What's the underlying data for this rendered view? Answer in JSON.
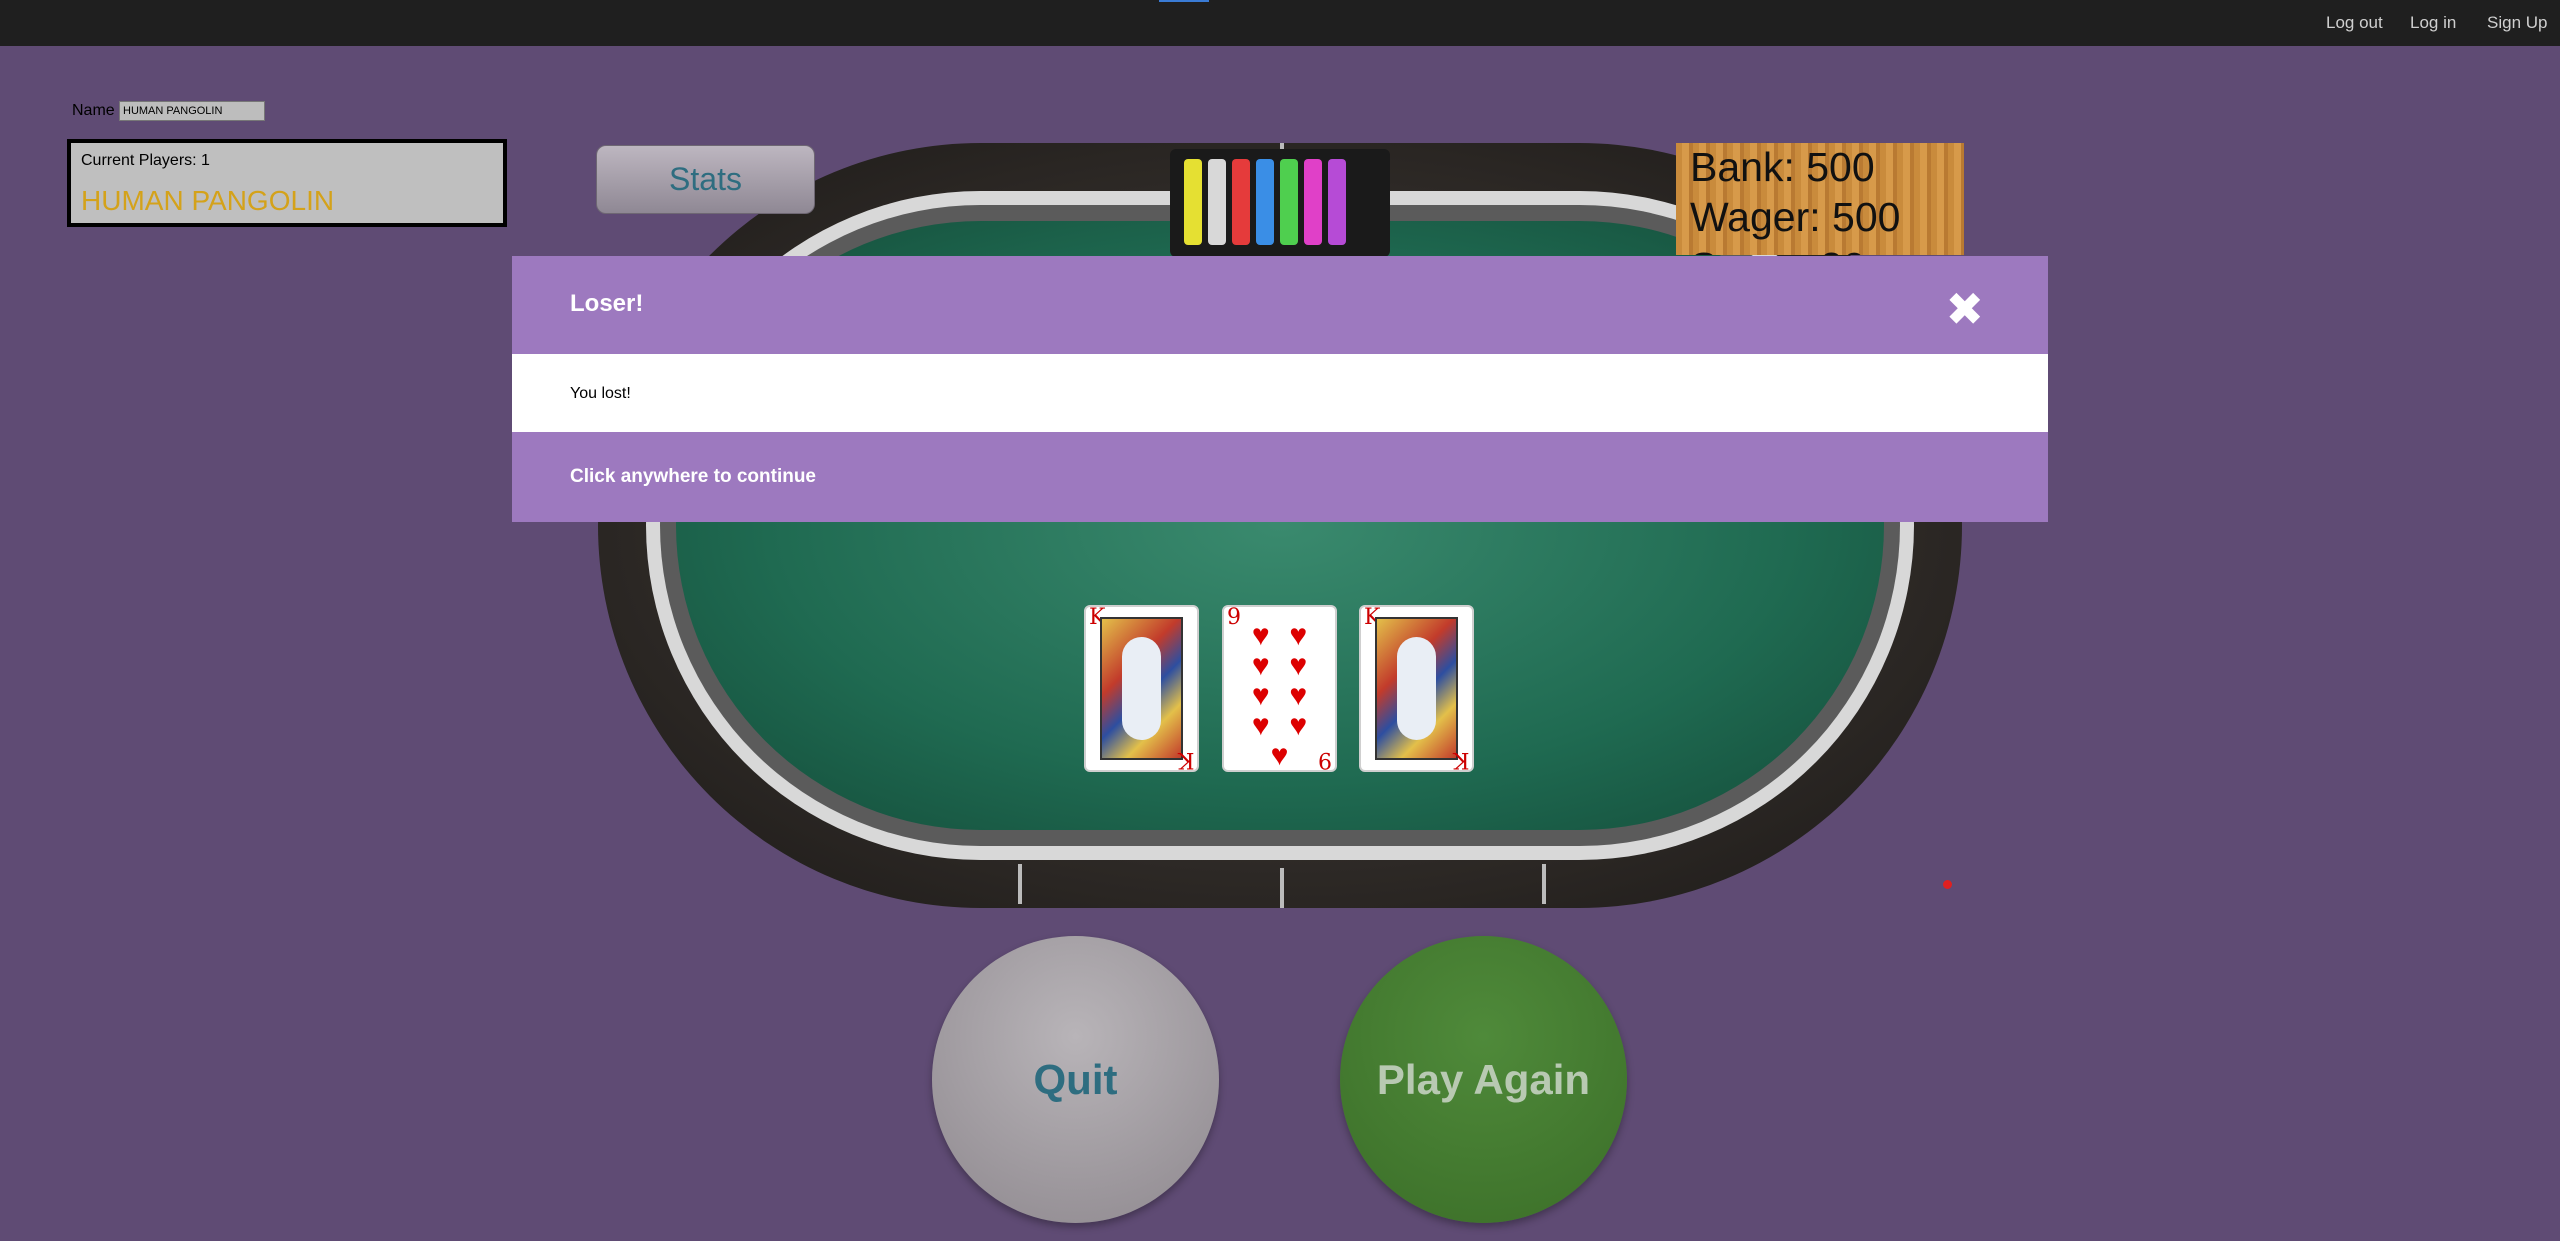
{
  "nav": {
    "logout": "Log out",
    "login": "Log in",
    "signup": "Sign Up"
  },
  "player": {
    "name_label": "Name",
    "name_value": "HUMAN PANGOLIN",
    "count_text": "Current Players: 1",
    "display_name": "HUMAN PANGOLIN"
  },
  "stats_button": "Stats",
  "bank": {
    "bank": "Bank: 500",
    "wager": "Wager: 500",
    "score": "Score: 20"
  },
  "cards": [
    {
      "rank": "K",
      "suit": "hearts",
      "suit_symbol": "♥"
    },
    {
      "rank": "9",
      "suit": "hearts",
      "suit_symbol": "♥"
    },
    {
      "rank": "K",
      "suit": "diamonds",
      "suit_symbol": "♦"
    }
  ],
  "modal": {
    "title": "Loser!",
    "message": "You lost!",
    "footer": "Click anywhere to continue",
    "close_icon": "close-icon"
  },
  "actions": {
    "quit": "Quit",
    "play_again": "Play Again"
  },
  "colors": {
    "background": "#5f4b74",
    "modal_accent": "#9d79bf",
    "player_name": "#d4a21a",
    "felt": "#1f6a51"
  },
  "chips": [
    "#e5e032",
    "#d8d8d8",
    "#e53b3b",
    "#3a8ee6",
    "#4fcf4f",
    "#e040c8",
    "#b64bd6"
  ]
}
